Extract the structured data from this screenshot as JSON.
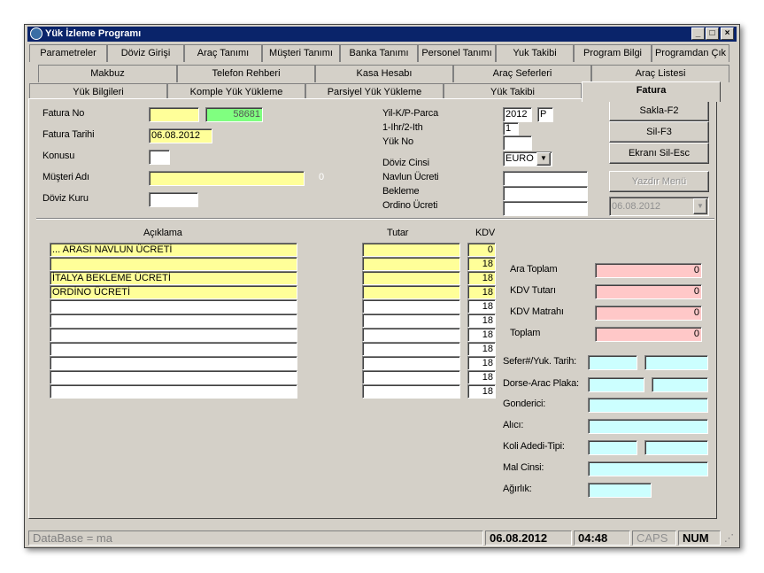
{
  "window": {
    "title": "Yük İzleme Programı",
    "minimize": "_",
    "maximize": "□",
    "close": "×"
  },
  "tabs_row1": [
    "Parametreler",
    "Döviz Girişi",
    "Araç Tanımı",
    "Müşteri Tanımı",
    "Banka Tanımı",
    "Personel Tanımı",
    "Yuk Takibi",
    "Program Bilgi",
    "Programdan Çık"
  ],
  "tabs_row2": [
    "Makbuz",
    "Telefon Rehberi",
    "Kasa Hesabı",
    "Araç Seferleri",
    "Araç Listesi"
  ],
  "tabs_row3": [
    "Yük Bilgileri",
    "Komple Yük Yükleme",
    "Parsiyel Yük Yükleme",
    "Yük Takibi",
    "Fatura"
  ],
  "form": {
    "fatura_no_label": "Fatura No",
    "fatura_no_value": "",
    "fatura_no_green": "58681",
    "fatura_tarihi_label": "Fatura Tarihi",
    "fatura_tarihi_value": "06.08.2012",
    "konusu_label": "Konusu",
    "musteri_adi_label": "Müşteri Adı",
    "musteri_zero": "0",
    "doviz_kuru_label": "Döviz Kuru",
    "yil_label": "Yil-K/P-Parca",
    "yil_value": "2012",
    "kp_value": "P",
    "ihr_label": "1-Ihr/2-Ith",
    "ihr_value": "1",
    "yuk_no_label": "Yük No",
    "doviz_cinsi_label": "Döviz Cinsi",
    "doviz_cinsi_value": "EURO",
    "navlun_label": "Navlun Ücreti",
    "bekleme_label": "Bekleme",
    "ordino_label": "Ordino Ücreti"
  },
  "buttons": {
    "save": "Sakla-F2",
    "delete": "Sil-F3",
    "clear": "Ekranı Sil-Esc",
    "print": "Yazdır Menü",
    "date_combo": "06.08.2012"
  },
  "table": {
    "col_aciklama": "Açıklama",
    "col_tutar": "Tutar",
    "col_kdv": "KDV",
    "rows": [
      {
        "aciklama": "...  ARASI NAVLUN ÜCRETİ",
        "kdv": "0",
        "y": true
      },
      {
        "aciklama": "",
        "kdv": "18",
        "y": true
      },
      {
        "aciklama": "İTALYA BEKLEME ÜCRETİ",
        "kdv": "18",
        "y": true
      },
      {
        "aciklama": "ORDİNO ÜCRETİ",
        "kdv": "18",
        "y": true
      },
      {
        "aciklama": "",
        "kdv": "18",
        "y": false
      },
      {
        "aciklama": "",
        "kdv": "18",
        "y": false
      },
      {
        "aciklama": "",
        "kdv": "18",
        "y": false
      },
      {
        "aciklama": "",
        "kdv": "18",
        "y": false
      },
      {
        "aciklama": "",
        "kdv": "18",
        "y": false
      },
      {
        "aciklama": "",
        "kdv": "18",
        "y": false
      },
      {
        "aciklama": "",
        "kdv": "18",
        "y": false
      }
    ]
  },
  "totals": {
    "ara_toplam_label": "Ara Toplam",
    "ara_toplam": "0",
    "kdv_tutari_label": "KDV Tutarı",
    "kdv_tutari": "0",
    "kdv_matrahi_label": "KDV Matrahı",
    "kdv_matrahi": "0",
    "toplam_label": "Toplam",
    "toplam": "0"
  },
  "shipping": {
    "sefer_label": "Sefer#/Yuk. Tarih:",
    "dorse_label": "Dorse-Arac Plaka:",
    "gonderici_label": "Gonderici:",
    "alici_label": "Alıcı:",
    "koli_label": "Koli Adedi-Tipi:",
    "mal_label": "Mal Cinsi:",
    "agirlik_label": "Ağırlık:"
  },
  "status": {
    "db": "DataBase = ma",
    "date": "06.08.2012",
    "time": "04:48",
    "caps": "CAPS",
    "num": "NUM"
  }
}
